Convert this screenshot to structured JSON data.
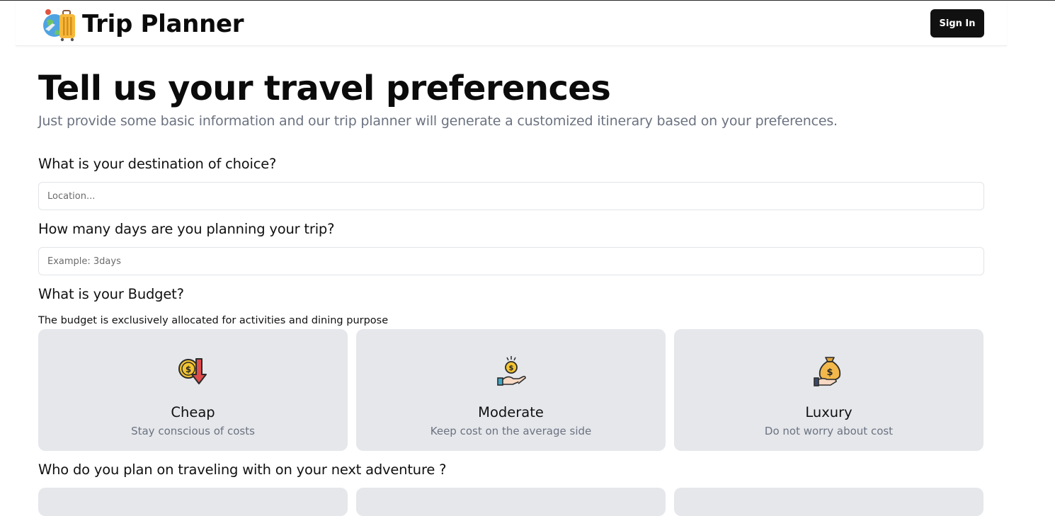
{
  "header": {
    "app_title": "Trip Planner",
    "sign_in_label": "Sign In"
  },
  "page": {
    "title": "Tell us your travel preferences",
    "subtitle": "Just provide some basic information and our trip planner will generate a customized itinerary based on your preferences."
  },
  "destination": {
    "question": "What is your destination of choice?",
    "placeholder": "Location...",
    "value": ""
  },
  "days": {
    "question": "How many days are you planning your trip?",
    "placeholder": "Example: 3days",
    "value": ""
  },
  "budget": {
    "question": "What is your Budget?",
    "note": "The budget is exclusively allocated for activities and dining purpose",
    "options": [
      {
        "title": "Cheap",
        "desc": "Stay conscious of costs",
        "icon": "coin-down-arrow-icon"
      },
      {
        "title": "Moderate",
        "desc": "Keep cost on the average side",
        "icon": "coin-hand-icon"
      },
      {
        "title": "Luxury",
        "desc": "Do not worry about cost",
        "icon": "money-bag-hand-icon"
      }
    ]
  },
  "travelers": {
    "question": "Who do you plan on traveling with on your next adventure ?"
  },
  "colors": {
    "card_bg": "#e5e7eb",
    "button_bg": "#111111",
    "muted_text": "#6b7280"
  }
}
